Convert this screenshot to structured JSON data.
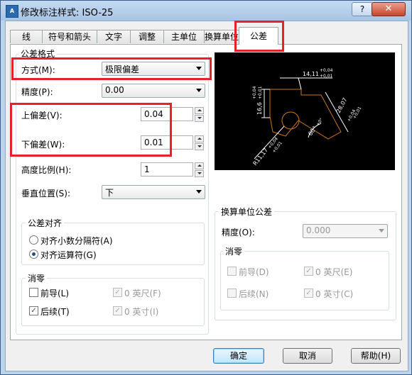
{
  "window": {
    "title": "修改标注样式: ISO-25",
    "icon_text": "A",
    "help_glyph": "?",
    "close_glyph": "✕"
  },
  "tabs": [
    {
      "label": "线"
    },
    {
      "label": "符号和箭头"
    },
    {
      "label": "文字"
    },
    {
      "label": "调整"
    },
    {
      "label": "主单位"
    },
    {
      "label": "换算单位"
    },
    {
      "label": "公差",
      "active": true
    }
  ],
  "tolerance_format": {
    "group_title": "公差格式",
    "method_label": "方式(M):",
    "method_value": "极限偏差",
    "precision_label": "精度(P):",
    "precision_value": "0.00",
    "upper_label": "上偏差(V):",
    "upper_value": "0.04",
    "lower_label": "下偏差(W):",
    "lower_value": "0.01",
    "height_label": "高度比例(H):",
    "height_value": "1",
    "vpos_label": "垂直位置(S):",
    "vpos_value": "下"
  },
  "alignment": {
    "group_title": "公差对齐",
    "decimal_label": "对齐小数分隔符(A)",
    "operator_label": "对齐运算符(G)",
    "selected": "operator"
  },
  "zero_suppression": {
    "group_title": "消零",
    "leading_label": "前导(L)",
    "leading_checked": false,
    "trailing_label": "后续(T)",
    "trailing_checked": true,
    "feet_label": "0 英尺(F)",
    "feet_checked": true,
    "inches_label": "0 英寸(I)",
    "inches_checked": true
  },
  "alt_unit_tolerance": {
    "group_title": "换算单位公差",
    "precision_label": "精度(O):",
    "precision_value": "0.000",
    "zero_title": "消零",
    "leading_label": "前导(D)",
    "trailing_label": "后续(N)",
    "feet_label": "0 英尺(E)",
    "inches_label": "0 英寸(C)"
  },
  "preview": {
    "dim_top": "14,11",
    "tol_top_plus": "+0,04",
    "tol_top_minus": "+0,01",
    "dim_left": "16,6",
    "tol_left_plus": "+0,04",
    "tol_left_minus": "+0,01",
    "dim_right": "28,07",
    "tol_right_plus": "+0,04",
    "tol_right_minus": "+0,01",
    "angle": "60°",
    "angle_tol": "+0°",
    "radius": "R11,17",
    "radius_tol_plus": "+0,04",
    "radius_tol_minus": "+0,01"
  },
  "buttons": {
    "ok": "确定",
    "cancel": "取消",
    "help": "帮助(H)"
  },
  "colors": {
    "highlight": "#e8202a",
    "preview_bg": "#000000",
    "preview_dim": "#ffffff",
    "preview_part": "#c8781e"
  }
}
